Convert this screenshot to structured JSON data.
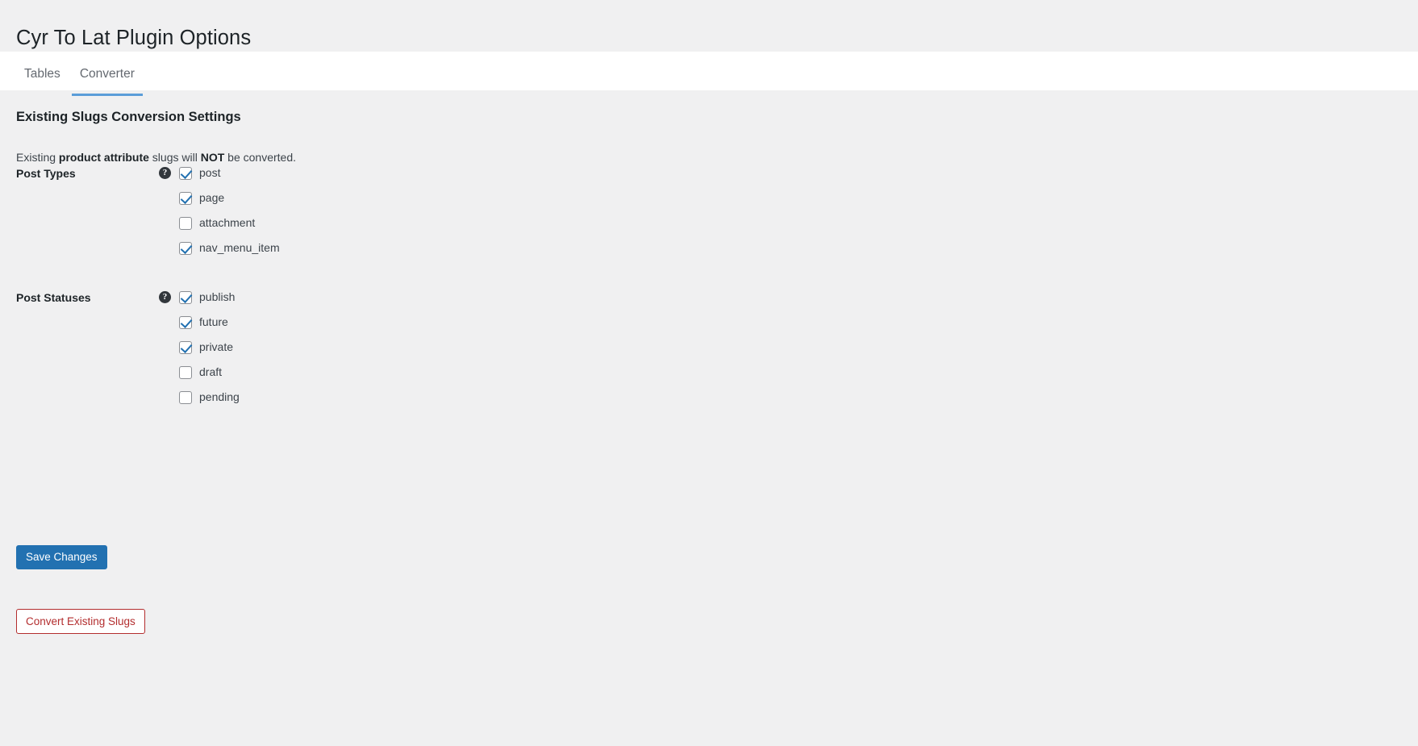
{
  "page": {
    "title": "Cyr To Lat Plugin Options"
  },
  "tabs": [
    {
      "label": "Tables",
      "active": false
    },
    {
      "label": "Converter",
      "active": true
    }
  ],
  "section": {
    "heading": "Existing Slugs Conversion Settings",
    "description_prefix": "Existing ",
    "description_bold1": "product attribute",
    "description_middle": " slugs will ",
    "description_bold2": "NOT",
    "description_suffix": " be converted."
  },
  "fields": [
    {
      "label": "Post Types",
      "help_icon": "help-circle-icon",
      "help_glyph": "?",
      "options": [
        {
          "label": "post",
          "checked": true
        },
        {
          "label": "page",
          "checked": true
        },
        {
          "label": "attachment",
          "checked": false
        },
        {
          "label": "nav_menu_item",
          "checked": true
        }
      ]
    },
    {
      "label": "Post Statuses",
      "help_icon": "help-circle-icon",
      "help_glyph": "?",
      "options": [
        {
          "label": "publish",
          "checked": true
        },
        {
          "label": "future",
          "checked": true
        },
        {
          "label": "private",
          "checked": true
        },
        {
          "label": "draft",
          "checked": false
        },
        {
          "label": "pending",
          "checked": false
        }
      ]
    }
  ],
  "buttons": {
    "save": "Save Changes",
    "convert": "Convert Existing Slugs"
  },
  "colors": {
    "page_background": "#f0f0f1",
    "tab_bar_background": "#ffffff",
    "active_tab_underline": "#5b9dd9",
    "primary_button": "#2271b1",
    "danger_button": "#b32d2e",
    "checkbox_check": "#2271b1",
    "help_icon_background": "#32373c",
    "heading_text": "#1d2327",
    "body_text": "#3c434a",
    "tab_text": "#646970"
  }
}
